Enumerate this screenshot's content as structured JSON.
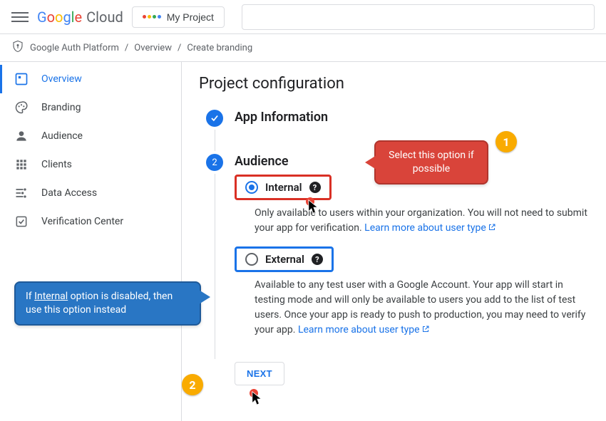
{
  "header": {
    "project_label": "My Project"
  },
  "logo": {
    "cloud": "Cloud"
  },
  "breadcrumb": {
    "items": [
      "Google Auth Platform",
      "Overview",
      "Create branding"
    ]
  },
  "sidebar": {
    "items": [
      {
        "label": "Overview"
      },
      {
        "label": "Branding"
      },
      {
        "label": "Audience"
      },
      {
        "label": "Clients"
      },
      {
        "label": "Data Access"
      },
      {
        "label": "Verification Center"
      }
    ]
  },
  "page": {
    "title": "Project configuration",
    "steps": {
      "app_info": {
        "title": "App Information"
      },
      "audience": {
        "number": "2",
        "title": "Audience",
        "internal": {
          "label": "Internal",
          "desc_pre": "Only available to users within your organization. You will not need to submit your app for verification. ",
          "link": "Learn more about user type"
        },
        "external": {
          "label": "External",
          "desc_pre": "Available to any test user with a Google Account. Your app will start in testing mode and will only be available to users you add to the list of test users. Once your app is ready to push to production, you may need to verify your app. ",
          "link": "Learn more about user type"
        }
      }
    },
    "next_label": "NEXT"
  },
  "annotations": {
    "callout1": "Select this option if possible",
    "callout2_pre": "If ",
    "callout2_u": "Internal",
    "callout2_post": " option is disabled, then use this option instead",
    "badge1": "1",
    "badge2": "2"
  }
}
